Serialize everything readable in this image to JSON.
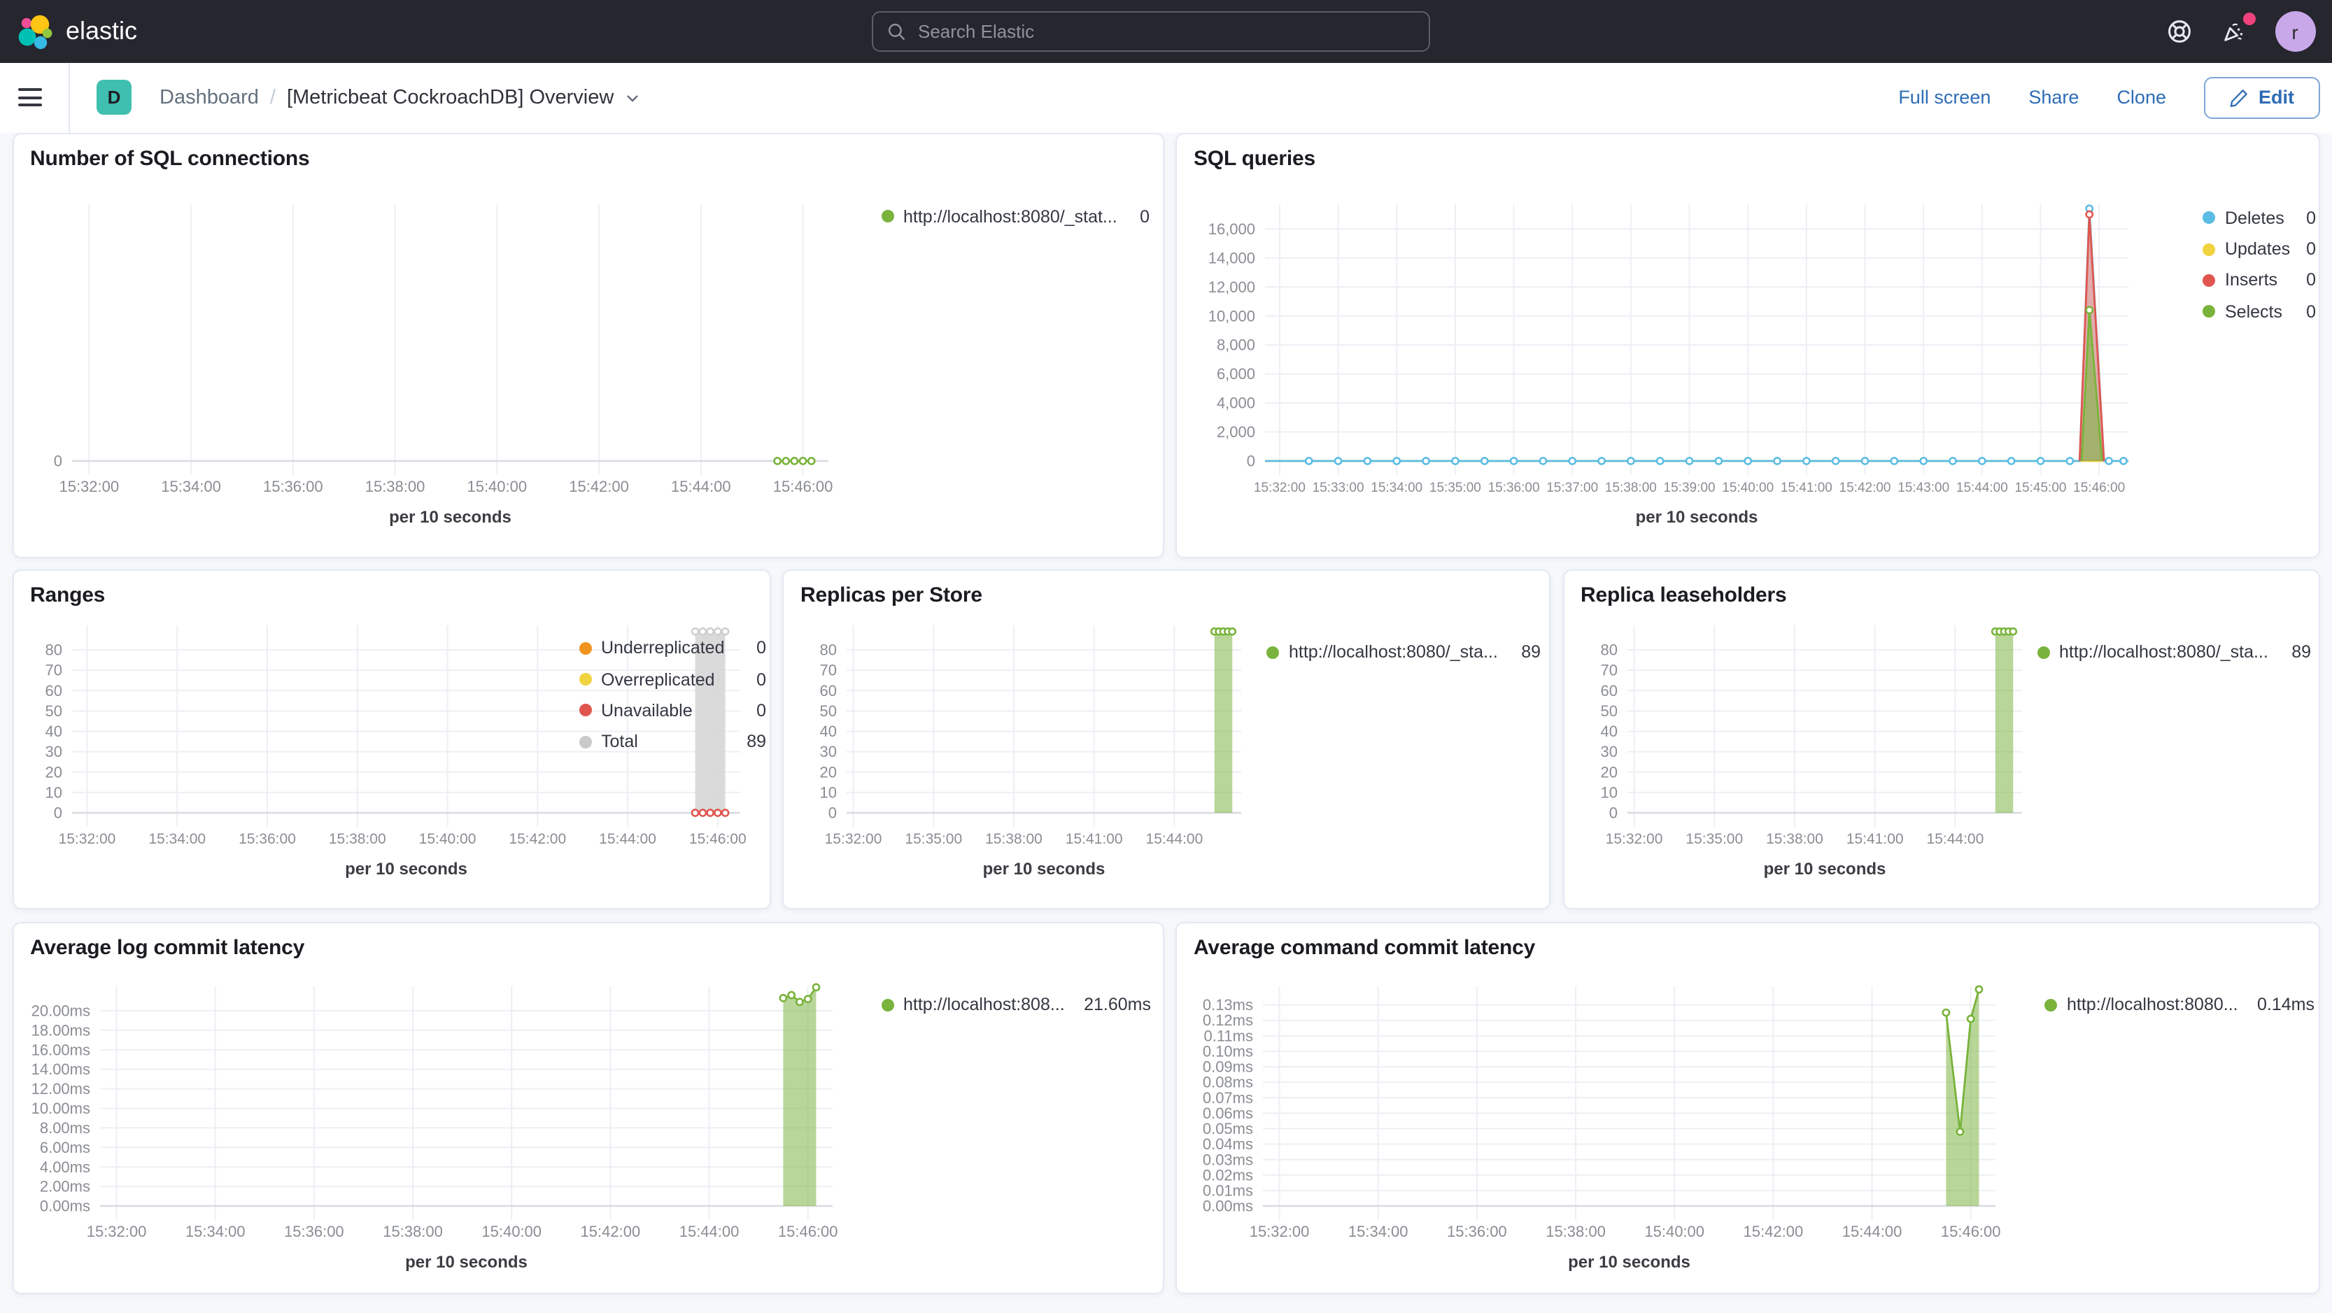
{
  "topbar": {
    "brand": "elastic",
    "search_placeholder": "Search Elastic",
    "avatar_initial": "r",
    "notification_dot_color": "#f0427c"
  },
  "toolbar": {
    "badge": "D",
    "breadcrumb_root": "Dashboard",
    "breadcrumb_sep": "/",
    "title": "[Metricbeat CockroachDB] Overview",
    "actions": {
      "full_screen": "Full screen",
      "share": "Share",
      "clone": "Clone",
      "edit": "Edit"
    }
  },
  "colors": {
    "topbar_bg": "#25262e",
    "link_blue": "#2e6cb5",
    "badge_teal": "#3fbfb0",
    "page_bg": "#f6f8fb",
    "panel_border": "#e3e8f2",
    "avatar_bg": "#c9a8e9",
    "series_green": "#79b33b",
    "series_blue": "#5bbce4",
    "series_red": "#e0564f",
    "series_yellow": "#f1d33f",
    "series_orange": "#f0941f",
    "series_gray": "#c9c9c9"
  },
  "charts": [
    {
      "id": "sql-connections",
      "title": "Number of SQL connections",
      "type": "line",
      "x_axis_label": "per 10 seconds",
      "x_domain": [
        "15:31:40",
        "15:46:30"
      ],
      "x_ticks": [
        "15:32:00",
        "15:34:00",
        "15:36:00",
        "15:38:00",
        "15:40:00",
        "15:42:00",
        "15:44:00",
        "15:46:00"
      ],
      "y_domain": [
        0,
        1
      ],
      "y_ticks": [
        {
          "v": 0,
          "label": "0"
        }
      ],
      "legend": [
        {
          "label": "http://localhost:8080/_stat...",
          "value": "0",
          "color": "#79b33b"
        }
      ],
      "series": [
        {
          "name": "connections",
          "color": "#79b33b",
          "fill": null,
          "path": [
            [
              "15:45:30",
              0
            ],
            [
              "15:46:10",
              0
            ]
          ],
          "marker_run": {
            "from": "15:45:30",
            "to": "15:46:10",
            "step_s": 10,
            "v": 0
          }
        }
      ]
    },
    {
      "id": "sql-queries",
      "title": "SQL queries",
      "type": "line",
      "x_axis_label": "per 10 seconds",
      "x_domain": [
        "15:31:45",
        "15:46:30"
      ],
      "x_ticks": [
        "15:32:00",
        "15:33:00",
        "15:34:00",
        "15:35:00",
        "15:36:00",
        "15:37:00",
        "15:38:00",
        "15:39:00",
        "15:40:00",
        "15:41:00",
        "15:42:00",
        "15:43:00",
        "15:44:00",
        "15:45:00",
        "15:46:00"
      ],
      "y_domain": [
        0,
        17700
      ],
      "y_ticks": [
        {
          "v": 0,
          "label": "0"
        },
        {
          "v": 2000,
          "label": "2,000"
        },
        {
          "v": 4000,
          "label": "4,000"
        },
        {
          "v": 6000,
          "label": "6,000"
        },
        {
          "v": 8000,
          "label": "8,000"
        },
        {
          "v": 10000,
          "label": "10,000"
        },
        {
          "v": 12000,
          "label": "12,000"
        },
        {
          "v": 14000,
          "label": "14,000"
        },
        {
          "v": 16000,
          "label": "16,000"
        }
      ],
      "legend": [
        {
          "label": "Deletes",
          "value": "0",
          "color": "#5bbce4"
        },
        {
          "label": "Updates",
          "value": "0",
          "color": "#f1d33f"
        },
        {
          "label": "Inserts",
          "value": "0",
          "color": "#e0564f"
        },
        {
          "label": "Selects",
          "value": "0",
          "color": "#79b33b"
        }
      ],
      "series": [
        {
          "name": "Updates",
          "color": "#f1d33f",
          "fill": null,
          "path": [
            [
              "15:31:45",
              0
            ],
            [
              "15:46:30",
              0
            ]
          ]
        },
        {
          "name": "Deletes",
          "color": "#5bbce4",
          "fill": "rgba(91,188,228,0.18)",
          "path": [
            [
              "15:31:45",
              0
            ],
            [
              "15:45:40",
              0
            ],
            [
              "15:45:50",
              17400
            ],
            [
              "15:46:05",
              0
            ],
            [
              "15:46:30",
              0
            ]
          ],
          "marker_run": {
            "from": "15:32:30",
            "to": "15:45:30",
            "step_s": 30,
            "v": 0
          },
          "markers": [
            [
              "15:45:50",
              17400
            ],
            [
              "15:46:10",
              0
            ],
            [
              "15:46:25",
              0
            ]
          ]
        },
        {
          "name": "Inserts",
          "color": "#e0564f",
          "fill": "rgba(224,86,79,0.45)",
          "path": [
            [
              "15:45:40",
              0
            ],
            [
              "15:45:50",
              17000
            ],
            [
              "15:46:05",
              0
            ]
          ],
          "markers": [
            [
              "15:45:50",
              17000
            ]
          ]
        },
        {
          "name": "Selects",
          "color": "#79b33b",
          "fill": "rgba(125,181,67,0.6)",
          "path": [
            [
              "15:45:42",
              0
            ],
            [
              "15:45:50",
              10400
            ],
            [
              "15:46:03",
              0
            ]
          ],
          "markers": [
            [
              "15:45:50",
              10400
            ]
          ]
        }
      ]
    },
    {
      "id": "ranges",
      "title": "Ranges",
      "type": "area",
      "x_axis_label": "per 10 seconds",
      "x_domain": [
        "15:31:40",
        "15:46:30"
      ],
      "x_ticks": [
        "15:32:00",
        "15:34:00",
        "15:36:00",
        "15:38:00",
        "15:40:00",
        "15:42:00",
        "15:44:00",
        "15:46:00"
      ],
      "y_domain": [
        0,
        92
      ],
      "y_ticks": [
        {
          "v": 0,
          "label": "0"
        },
        {
          "v": 10,
          "label": "10"
        },
        {
          "v": 20,
          "label": "20"
        },
        {
          "v": 30,
          "label": "30"
        },
        {
          "v": 40,
          "label": "40"
        },
        {
          "v": 50,
          "label": "50"
        },
        {
          "v": 60,
          "label": "60"
        },
        {
          "v": 70,
          "label": "70"
        },
        {
          "v": 80,
          "label": "80"
        }
      ],
      "legend": [
        {
          "label": "Underreplicated",
          "value": "0",
          "color": "#f0941f"
        },
        {
          "label": "Overreplicated",
          "value": "0",
          "color": "#f1d33f"
        },
        {
          "label": "Unavailable",
          "value": "0",
          "color": "#e0564f"
        },
        {
          "label": "Total",
          "value": "89",
          "color": "#c9c9c9"
        }
      ],
      "series": [
        {
          "name": "Total",
          "color": "#cfcfcf",
          "fill": "rgba(211,211,211,0.85)",
          "path": [
            [
              "15:45:30",
              89
            ],
            [
              "15:46:10",
              89
            ]
          ],
          "marker_run": {
            "from": "15:45:30",
            "to": "15:46:10",
            "step_s": 10,
            "v": 89
          }
        },
        {
          "name": "Unavailable",
          "color": "#e0564f",
          "fill": null,
          "path": [
            [
              "15:45:30",
              0
            ],
            [
              "15:46:10",
              0
            ]
          ],
          "marker_run": {
            "from": "15:45:30",
            "to": "15:46:10",
            "step_s": 10,
            "v": 0
          }
        }
      ]
    },
    {
      "id": "replicas",
      "title": "Replicas per Store",
      "type": "area",
      "x_axis_label": "per 10 seconds",
      "x_domain": [
        "15:31:45",
        "15:46:30"
      ],
      "x_ticks": [
        "15:32:00",
        "15:35:00",
        "15:38:00",
        "15:41:00",
        "15:44:00"
      ],
      "y_domain": [
        0,
        92
      ],
      "y_ticks": [
        {
          "v": 0,
          "label": "0"
        },
        {
          "v": 10,
          "label": "10"
        },
        {
          "v": 20,
          "label": "20"
        },
        {
          "v": 30,
          "label": "30"
        },
        {
          "v": 40,
          "label": "40"
        },
        {
          "v": 50,
          "label": "50"
        },
        {
          "v": 60,
          "label": "60"
        },
        {
          "v": 70,
          "label": "70"
        },
        {
          "v": 80,
          "label": "80"
        }
      ],
      "legend": [
        {
          "label": "http://localhost:8080/_sta...",
          "value": "89",
          "color": "#79b33b"
        }
      ],
      "series": [
        {
          "name": "replicas",
          "color": "#79b33b",
          "fill": "rgba(125,181,67,0.55)",
          "path": [
            [
              "15:45:30",
              89
            ],
            [
              "15:46:10",
              89
            ]
          ],
          "marker_run": {
            "from": "15:45:30",
            "to": "15:46:10",
            "step_s": 10,
            "v": 89
          }
        }
      ]
    },
    {
      "id": "leaseholders",
      "title": "Replica leaseholders",
      "type": "area",
      "x_axis_label": "per 10 seconds",
      "x_domain": [
        "15:31:45",
        "15:46:30"
      ],
      "x_ticks": [
        "15:32:00",
        "15:35:00",
        "15:38:00",
        "15:41:00",
        "15:44:00"
      ],
      "y_domain": [
        0,
        92
      ],
      "y_ticks": [
        {
          "v": 0,
          "label": "0"
        },
        {
          "v": 10,
          "label": "10"
        },
        {
          "v": 20,
          "label": "20"
        },
        {
          "v": 30,
          "label": "30"
        },
        {
          "v": 40,
          "label": "40"
        },
        {
          "v": 50,
          "label": "50"
        },
        {
          "v": 60,
          "label": "60"
        },
        {
          "v": 70,
          "label": "70"
        },
        {
          "v": 80,
          "label": "80"
        }
      ],
      "legend": [
        {
          "label": "http://localhost:8080/_sta...",
          "value": "89",
          "color": "#79b33b"
        }
      ],
      "series": [
        {
          "name": "leaseholders",
          "color": "#79b33b",
          "fill": "rgba(125,181,67,0.55)",
          "path": [
            [
              "15:45:30",
              89
            ],
            [
              "15:46:10",
              89
            ]
          ],
          "marker_run": {
            "from": "15:45:30",
            "to": "15:46:10",
            "step_s": 10,
            "v": 89
          }
        }
      ]
    },
    {
      "id": "log-commit",
      "title": "Average log commit latency",
      "type": "area",
      "x_axis_label": "per 10 seconds",
      "x_domain": [
        "15:31:40",
        "15:46:30"
      ],
      "x_ticks": [
        "15:32:00",
        "15:34:00",
        "15:36:00",
        "15:38:00",
        "15:40:00",
        "15:42:00",
        "15:44:00",
        "15:46:00"
      ],
      "y_domain": [
        0,
        22.5
      ],
      "y_ticks": [
        {
          "v": 0,
          "label": "0.00ms"
        },
        {
          "v": 2,
          "label": "2.00ms"
        },
        {
          "v": 4,
          "label": "4.00ms"
        },
        {
          "v": 6,
          "label": "6.00ms"
        },
        {
          "v": 8,
          "label": "8.00ms"
        },
        {
          "v": 10,
          "label": "10.00ms"
        },
        {
          "v": 12,
          "label": "12.00ms"
        },
        {
          "v": 14,
          "label": "14.00ms"
        },
        {
          "v": 16,
          "label": "16.00ms"
        },
        {
          "v": 18,
          "label": "18.00ms"
        },
        {
          "v": 20,
          "label": "20.00ms"
        }
      ],
      "legend": [
        {
          "label": "http://localhost:808...",
          "value": "21.60ms",
          "color": "#79b33b"
        }
      ],
      "series": [
        {
          "name": "log commit latency",
          "color": "#79b33b",
          "fill": "rgba(125,181,67,0.55)",
          "path": [
            [
              "15:45:30",
              21.3
            ],
            [
              "15:45:40",
              21.6
            ],
            [
              "15:45:50",
              20.9
            ],
            [
              "15:46:00",
              21.2
            ],
            [
              "15:46:10",
              22.4
            ]
          ],
          "markers": [
            [
              "15:45:30",
              21.3
            ],
            [
              "15:45:40",
              21.6
            ],
            [
              "15:45:50",
              20.9
            ],
            [
              "15:46:00",
              21.2
            ],
            [
              "15:46:10",
              22.4
            ]
          ]
        }
      ]
    },
    {
      "id": "cmd-commit",
      "title": "Average command commit latency",
      "type": "area",
      "x_axis_label": "per 10 seconds",
      "x_domain": [
        "15:31:40",
        "15:46:30"
      ],
      "x_ticks": [
        "15:32:00",
        "15:34:00",
        "15:36:00",
        "15:38:00",
        "15:40:00",
        "15:42:00",
        "15:44:00",
        "15:46:00"
      ],
      "y_domain": [
        0,
        0.142
      ],
      "y_ticks": [
        {
          "v": 0,
          "label": "0.00ms"
        },
        {
          "v": 0.01,
          "label": "0.01ms"
        },
        {
          "v": 0.02,
          "label": "0.02ms"
        },
        {
          "v": 0.03,
          "label": "0.03ms"
        },
        {
          "v": 0.04,
          "label": "0.04ms"
        },
        {
          "v": 0.05,
          "label": "0.05ms"
        },
        {
          "v": 0.06,
          "label": "0.06ms"
        },
        {
          "v": 0.07,
          "label": "0.07ms"
        },
        {
          "v": 0.08,
          "label": "0.08ms"
        },
        {
          "v": 0.09,
          "label": "0.09ms"
        },
        {
          "v": 0.1,
          "label": "0.10ms"
        },
        {
          "v": 0.11,
          "label": "0.11ms"
        },
        {
          "v": 0.12,
          "label": "0.12ms"
        },
        {
          "v": 0.13,
          "label": "0.13ms"
        }
      ],
      "legend": [
        {
          "label": "http://localhost:8080...",
          "value": "0.14ms",
          "color": "#79b33b"
        }
      ],
      "series": [
        {
          "name": "command commit latency",
          "color": "#79b33b",
          "fill": "rgba(125,181,67,0.55)",
          "path": [
            [
              "15:45:30",
              0.125
            ],
            [
              "15:45:47",
              0.048
            ],
            [
              "15:46:00",
              0.121
            ],
            [
              "15:46:10",
              0.14
            ]
          ],
          "markers": [
            [
              "15:45:30",
              0.125
            ],
            [
              "15:45:47",
              0.048
            ],
            [
              "15:46:00",
              0.121
            ],
            [
              "15:46:10",
              0.14
            ]
          ]
        }
      ]
    }
  ]
}
